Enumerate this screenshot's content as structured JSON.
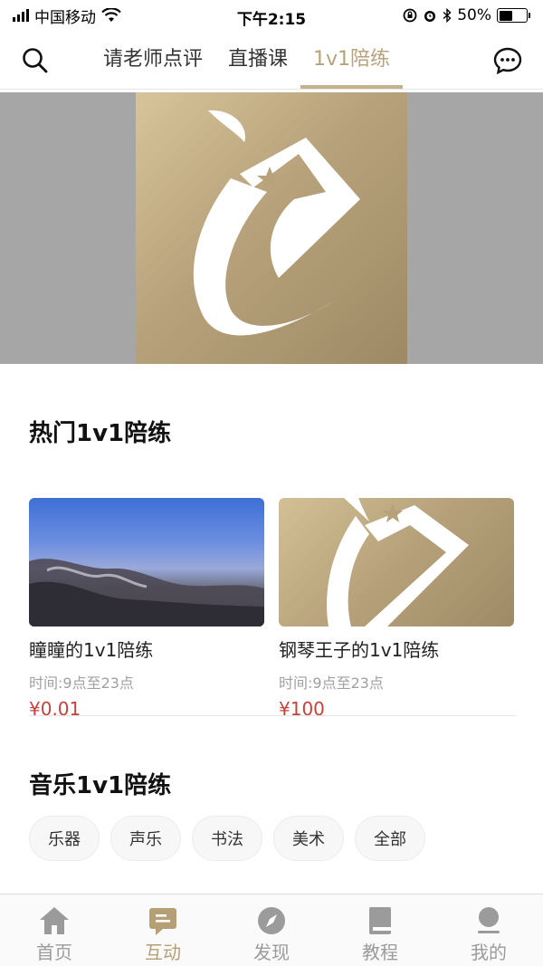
{
  "status": {
    "carrier": "中国移动",
    "time": "下午2:15",
    "battery": "50%"
  },
  "nav": {
    "tabs": [
      "请老师点评",
      "直播课",
      "1v1陪练"
    ],
    "active_tab": 2
  },
  "hot": {
    "title": "热门1v1陪练",
    "cards": [
      {
        "title": "瞳瞳的1v1陪练",
        "time": "时间:9点至23点",
        "price": "¥0.01"
      },
      {
        "title": "钢琴王子的1v1陪练",
        "time": "时间:9点至23点",
        "price": "¥100"
      }
    ]
  },
  "music": {
    "title": "音乐1v1陪练",
    "chips": [
      "乐器",
      "声乐",
      "书法",
      "美术",
      "全部"
    ]
  },
  "bottom_nav": {
    "items": [
      "首页",
      "互动",
      "发现",
      "教程",
      "我的"
    ],
    "active": 1
  },
  "colors": {
    "accent": "#b59f76",
    "price": "#c4423a"
  }
}
